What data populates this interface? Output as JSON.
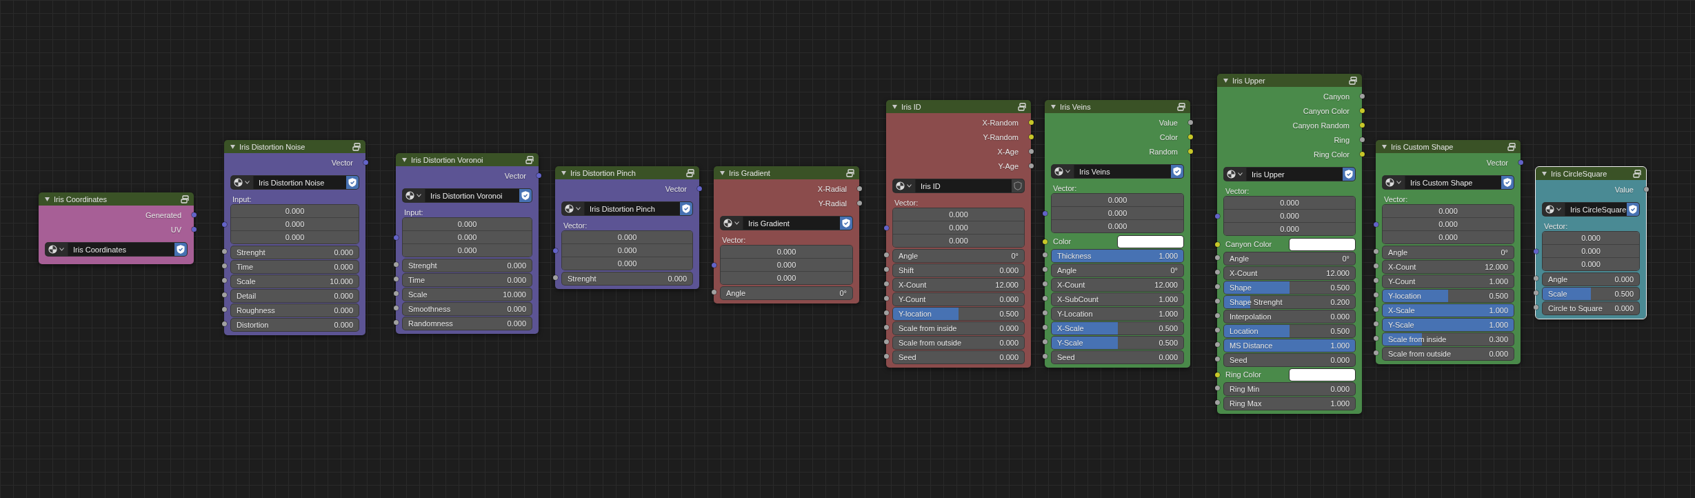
{
  "nodes": [
    {
      "title": "Iris Coordinates",
      "color": "#a75f96",
      "selected": false,
      "outputs": [
        {
          "label": "Generated",
          "socket": {
            "color": "#6363c7"
          }
        },
        {
          "label": "UV",
          "socket": {
            "color": "#6363c7"
          }
        }
      ],
      "datablock": {
        "name": "Iris Coordinates",
        "fake_user": true
      }
    },
    {
      "title": "Iris Distortion Noise",
      "color": "#5c5494",
      "selected": false,
      "outputs": [
        {
          "label": "Vector",
          "socket": {
            "color": "#6363c7"
          }
        }
      ],
      "datablock": {
        "name": "Iris Distortion Noise",
        "fake_user": true
      },
      "inputs": [
        {
          "kind": "heading",
          "label": "Input:"
        },
        {
          "kind": "vector",
          "socket": {
            "color": "#6363c7"
          },
          "values": [
            "0.000",
            "0.000",
            "0.000"
          ]
        },
        {
          "kind": "value",
          "socket": {
            "color": "#a1a1a1"
          },
          "label": "Strenght",
          "value": "0.000"
        },
        {
          "kind": "value",
          "socket": {
            "color": "#a1a1a1"
          },
          "label": "Time",
          "value": "0.000"
        },
        {
          "kind": "value",
          "socket": {
            "color": "#a1a1a1"
          },
          "label": "Scale",
          "value": "10.000"
        },
        {
          "kind": "value",
          "socket": {
            "color": "#a1a1a1"
          },
          "label": "Detail",
          "value": "0.000"
        },
        {
          "kind": "value",
          "socket": {
            "color": "#a1a1a1"
          },
          "label": "Roughness",
          "value": "0.000"
        },
        {
          "kind": "value",
          "socket": {
            "color": "#a1a1a1"
          },
          "label": "Distortion",
          "value": "0.000"
        }
      ]
    },
    {
      "title": "Iris Distortion Voronoi",
      "color": "#5c5494",
      "selected": false,
      "outputs": [
        {
          "label": "Vector",
          "socket": {
            "color": "#6363c7"
          }
        }
      ],
      "datablock": {
        "name": "Iris Distortion Voronoi",
        "fake_user": true
      },
      "inputs": [
        {
          "kind": "heading",
          "label": "Input:"
        },
        {
          "kind": "vector",
          "socket": {
            "color": "#6363c7"
          },
          "values": [
            "0.000",
            "0.000",
            "0.000"
          ]
        },
        {
          "kind": "value",
          "socket": {
            "color": "#a1a1a1"
          },
          "label": "Strenght",
          "value": "0.000"
        },
        {
          "kind": "value",
          "socket": {
            "color": "#a1a1a1"
          },
          "label": "Time",
          "value": "0.000"
        },
        {
          "kind": "value",
          "socket": {
            "color": "#a1a1a1"
          },
          "label": "Scale",
          "value": "10.000"
        },
        {
          "kind": "value",
          "socket": {
            "color": "#a1a1a1"
          },
          "label": "Smoothness",
          "value": "0.000"
        },
        {
          "kind": "value",
          "socket": {
            "color": "#a1a1a1"
          },
          "label": "Randomness",
          "value": "0.000"
        }
      ]
    },
    {
      "title": "Iris Distortion Pinch",
      "color": "#5c5494",
      "selected": false,
      "outputs": [
        {
          "label": "Vector",
          "socket": {
            "color": "#6363c7"
          }
        }
      ],
      "datablock": {
        "name": "Iris Distortion Pinch",
        "fake_user": true
      },
      "inputs": [
        {
          "kind": "heading",
          "label": "Vector:"
        },
        {
          "kind": "vector",
          "socket": {
            "color": "#6363c7"
          },
          "values": [
            "0.000",
            "0.000",
            "0.000"
          ]
        },
        {
          "kind": "value",
          "socket": {
            "color": "#a1a1a1"
          },
          "label": "Strenght",
          "value": "0.000"
        }
      ]
    },
    {
      "title": "Iris Gradient",
      "color": "#8b4c4c",
      "selected": false,
      "outputs": [
        {
          "label": "X-Radial",
          "socket": {
            "color": "#a1a1a1"
          }
        },
        {
          "label": "Y-Radial",
          "socket": {
            "color": "#a1a1a1"
          }
        }
      ],
      "datablock": {
        "name": "Iris Gradient",
        "fake_user": true
      },
      "inputs": [
        {
          "kind": "heading",
          "label": "Vector:"
        },
        {
          "kind": "vector",
          "socket": {
            "color": "#6363c7"
          },
          "values": [
            "0.000",
            "0.000",
            "0.000"
          ]
        },
        {
          "kind": "value",
          "socket": {
            "color": "#a1a1a1"
          },
          "label": "Angle",
          "value": "0°"
        }
      ]
    },
    {
      "title": "Iris ID",
      "color": "#8b4c4c",
      "selected": false,
      "outputs": [
        {
          "label": "X-Random",
          "socket": {
            "color": "#c7c729"
          }
        },
        {
          "label": "Y-Random",
          "socket": {
            "color": "#c7c729"
          }
        },
        {
          "label": "X-Age",
          "socket": {
            "color": "#a1a1a1"
          }
        },
        {
          "label": "Y-Age",
          "socket": {
            "color": "#a1a1a1"
          }
        }
      ],
      "datablock": {
        "name": "Iris ID",
        "fake_user": false
      },
      "inputs": [
        {
          "kind": "heading",
          "label": "Vector:"
        },
        {
          "kind": "vector",
          "socket": {
            "color": "#6363c7"
          },
          "values": [
            "0.000",
            "0.000",
            "0.000"
          ]
        },
        {
          "kind": "value",
          "socket": {
            "color": "#a1a1a1"
          },
          "label": "Angle",
          "value": "0°"
        },
        {
          "kind": "value",
          "socket": {
            "color": "#a1a1a1"
          },
          "label": "Shift",
          "value": "0.000"
        },
        {
          "kind": "value",
          "socket": {
            "color": "#a1a1a1"
          },
          "label": "X-Count",
          "value": "12.000"
        },
        {
          "kind": "value",
          "socket": {
            "color": "#a1a1a1"
          },
          "label": "Y-Count",
          "value": "0.000"
        },
        {
          "kind": "slider",
          "socket": {
            "color": "#a1a1a1"
          },
          "label": "Y-location",
          "value": "0.500",
          "level": 0.5
        },
        {
          "kind": "value",
          "socket": {
            "color": "#a1a1a1"
          },
          "label": "Scale from inside",
          "value": "0.000"
        },
        {
          "kind": "value",
          "socket": {
            "color": "#a1a1a1"
          },
          "label": "Scale from outside",
          "value": "0.000"
        },
        {
          "kind": "value",
          "socket": {
            "color": "#a1a1a1"
          },
          "label": "Seed",
          "value": "0.000"
        }
      ]
    },
    {
      "title": "Iris Veins",
      "color": "#4a8a4a",
      "selected": false,
      "outputs": [
        {
          "label": "Value",
          "socket": {
            "color": "#a1a1a1"
          }
        },
        {
          "label": "Color",
          "socket": {
            "color": "#c7c729"
          }
        },
        {
          "label": "Random",
          "socket": {
            "color": "#c7c729"
          }
        }
      ],
      "datablock": {
        "name": "Iris Veins",
        "fake_user": true
      },
      "inputs": [
        {
          "kind": "heading",
          "label": "Vector:"
        },
        {
          "kind": "vector",
          "socket": {
            "color": "#6363c7"
          },
          "values": [
            "0.000",
            "0.000",
            "0.000"
          ]
        },
        {
          "kind": "color",
          "socket": {
            "color": "#c7c729"
          },
          "label": "Color",
          "color": "#ffffff"
        },
        {
          "kind": "slider",
          "socket": {
            "color": "#a1a1a1"
          },
          "label": "Thickness",
          "value": "1.000",
          "level": 1
        },
        {
          "kind": "value",
          "socket": {
            "color": "#a1a1a1"
          },
          "label": "Angle",
          "value": "0°"
        },
        {
          "kind": "value",
          "socket": {
            "color": "#a1a1a1"
          },
          "label": "X-Count",
          "value": "12.000"
        },
        {
          "kind": "value",
          "socket": {
            "color": "#a1a1a1"
          },
          "label": "X-SubCount",
          "value": "1.000"
        },
        {
          "kind": "value",
          "socket": {
            "color": "#a1a1a1"
          },
          "label": "Y-Location",
          "value": "1.000"
        },
        {
          "kind": "slider",
          "socket": {
            "color": "#a1a1a1"
          },
          "label": "X-Scale",
          "value": "0.500",
          "level": 0.5
        },
        {
          "kind": "slider",
          "socket": {
            "color": "#a1a1a1"
          },
          "label": "Y-Scale",
          "value": "0.500",
          "level": 0.5
        },
        {
          "kind": "value",
          "socket": {
            "color": "#a1a1a1"
          },
          "label": "Seed",
          "value": "0.000"
        }
      ]
    },
    {
      "title": "Iris Upper",
      "color": "#4a8a4a",
      "selected": false,
      "outputs": [
        {
          "label": "Canyon",
          "socket": {
            "color": "#a1a1a1"
          }
        },
        {
          "label": "Canyon Color",
          "socket": {
            "color": "#c7c729"
          }
        },
        {
          "label": "Canyon Random",
          "socket": {
            "color": "#c7c729"
          }
        },
        {
          "label": "Ring",
          "socket": {
            "color": "#a1a1a1"
          }
        },
        {
          "label": "Ring Color",
          "socket": {
            "color": "#c7c729"
          }
        }
      ],
      "datablock": {
        "name": "Iris Upper",
        "fake_user": true
      },
      "inputs": [
        {
          "kind": "heading",
          "label": "Vector:"
        },
        {
          "kind": "vector",
          "socket": {
            "color": "#6363c7"
          },
          "values": [
            "0.000",
            "0.000",
            "0.000"
          ]
        },
        {
          "kind": "color",
          "socket": {
            "color": "#c7c729"
          },
          "label": "Canyon Color",
          "color": "#ffffff"
        },
        {
          "kind": "value",
          "socket": {
            "color": "#a1a1a1"
          },
          "label": "Angle",
          "value": "0°"
        },
        {
          "kind": "value",
          "socket": {
            "color": "#a1a1a1"
          },
          "label": "X-Count",
          "value": "12.000"
        },
        {
          "kind": "slider",
          "socket": {
            "color": "#a1a1a1"
          },
          "label": "Shape",
          "value": "0.500",
          "level": 0.5
        },
        {
          "kind": "slider",
          "socket": {
            "color": "#a1a1a1"
          },
          "label": "Shape Strenght",
          "value": "0.200",
          "level": 0.2
        },
        {
          "kind": "value",
          "socket": {
            "color": "#a1a1a1"
          },
          "label": "Interpolation",
          "value": "0.000"
        },
        {
          "kind": "slider",
          "socket": {
            "color": "#a1a1a1"
          },
          "label": "Location",
          "value": "0.500",
          "level": 0.5
        },
        {
          "kind": "slider",
          "socket": {
            "color": "#a1a1a1"
          },
          "label": "MS Distance",
          "value": "1.000",
          "level": 1
        },
        {
          "kind": "value",
          "socket": {
            "color": "#a1a1a1"
          },
          "label": "Seed",
          "value": "0.000"
        },
        {
          "kind": "color",
          "socket": {
            "color": "#c7c729"
          },
          "label": "Ring Color",
          "color": "#ffffff"
        },
        {
          "kind": "value",
          "socket": {
            "color": "#a1a1a1"
          },
          "label": "Ring Min",
          "value": "0.000"
        },
        {
          "kind": "value",
          "socket": {
            "color": "#a1a1a1"
          },
          "label": "Ring Max",
          "value": "1.000"
        }
      ]
    },
    {
      "title": "Iris Custom Shape",
      "color": "#4a8a4a",
      "selected": false,
      "outputs": [
        {
          "label": "Vector",
          "socket": {
            "color": "#6363c7"
          }
        }
      ],
      "datablock": {
        "name": "Iris Custom Shape",
        "fake_user": true
      },
      "inputs": [
        {
          "kind": "heading",
          "label": "Vector:"
        },
        {
          "kind": "vector",
          "socket": {
            "color": "#6363c7"
          },
          "values": [
            "0.000",
            "0.000",
            "0.000"
          ]
        },
        {
          "kind": "value",
          "socket": {
            "color": "#a1a1a1"
          },
          "label": "Angle",
          "value": "0°"
        },
        {
          "kind": "value",
          "socket": {
            "color": "#a1a1a1"
          },
          "label": "X-Count",
          "value": "12.000"
        },
        {
          "kind": "value",
          "socket": {
            "color": "#a1a1a1"
          },
          "label": "Y-Count",
          "value": "1.000"
        },
        {
          "kind": "slider",
          "socket": {
            "color": "#a1a1a1"
          },
          "label": "Y-location",
          "value": "0.500",
          "level": 0.5
        },
        {
          "kind": "slider",
          "socket": {
            "color": "#a1a1a1"
          },
          "label": "X-Scale",
          "value": "1.000",
          "level": 1
        },
        {
          "kind": "slider",
          "socket": {
            "color": "#a1a1a1"
          },
          "label": "Y-Scale",
          "value": "1.000",
          "level": 1
        },
        {
          "kind": "slider",
          "socket": {
            "color": "#a1a1a1"
          },
          "label": "Scale from inside",
          "value": "0.300",
          "level": 0.3
        },
        {
          "kind": "value",
          "socket": {
            "color": "#a1a1a1"
          },
          "label": "Scale from outside",
          "value": "0.000"
        }
      ]
    },
    {
      "title": "Iris CircleSquare",
      "color": "#4a8a94",
      "selected": true,
      "outputs": [
        {
          "label": "Value",
          "socket": {
            "color": "#a1a1a1"
          }
        }
      ],
      "datablock": {
        "name": "Iris CircleSquare",
        "fake_user": true
      },
      "inputs": [
        {
          "kind": "heading",
          "label": "Vector:"
        },
        {
          "kind": "vector",
          "socket": {
            "color": "#6363c7"
          },
          "values": [
            "0.000",
            "0.000",
            "0.000"
          ]
        },
        {
          "kind": "value",
          "socket": {
            "color": "#a1a1a1"
          },
          "label": "Angle",
          "value": "0.000"
        },
        {
          "kind": "slider",
          "socket": {
            "color": "#a1a1a1"
          },
          "label": "Scale",
          "value": "0.500",
          "level": 0.5
        },
        {
          "kind": "value",
          "socket": {
            "color": "#a1a1a1"
          },
          "label": "Circle to Square",
          "value": "0.000"
        }
      ]
    }
  ]
}
